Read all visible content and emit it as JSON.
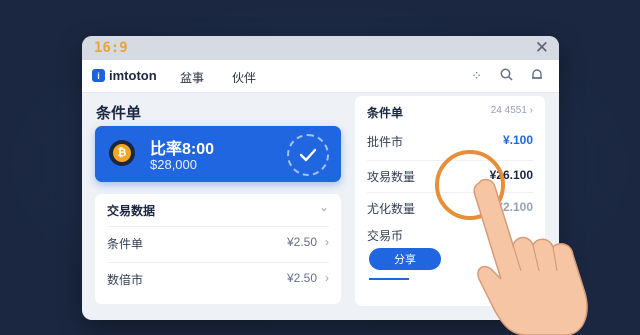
{
  "window": {
    "ratio": "16:9",
    "close_symbol": "✕"
  },
  "nav": {
    "logo_mark": "i",
    "logo_text": "imtoton",
    "items": [
      {
        "label": "盆事"
      },
      {
        "label": "伙伴"
      }
    ],
    "icons": [
      "more-icon",
      "search-icon",
      "notification-icon"
    ]
  },
  "left": {
    "title": "条件单",
    "card": {
      "title": "比率8:00",
      "value": "$28,000",
      "coin_symbol": "₿"
    },
    "panel": {
      "header": "交易数据",
      "rows": [
        {
          "label": "条件单",
          "value": "¥2.50"
        },
        {
          "label": "数偣市",
          "value": "¥2.50"
        }
      ]
    }
  },
  "right": {
    "header": "条件单",
    "header_num": "24 4551",
    "rows": [
      {
        "label": "批件市",
        "value": "¥.100",
        "color": "#1f66e0"
      },
      {
        "label": "攻易数量",
        "value": "¥26.100",
        "color": "#1b2740"
      },
      {
        "label": "尤化数量",
        "value": "¥2.100",
        "color": "#98a2b3"
      },
      {
        "label": "交易币",
        "value": "",
        "color": "#1b2740"
      }
    ],
    "share_button": "分享"
  },
  "colors": {
    "accent": "#1f66e0",
    "highlight_ring": "#e58f3a",
    "coin": "#f2a623"
  }
}
